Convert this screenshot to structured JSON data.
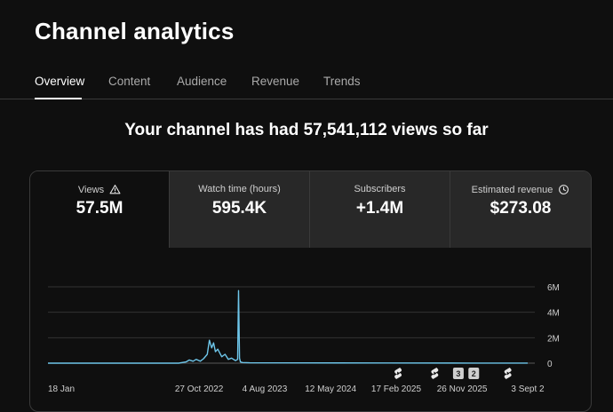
{
  "page": {
    "title": "Channel analytics"
  },
  "tabs": [
    {
      "label": "Overview",
      "active": true
    },
    {
      "label": "Content",
      "active": false
    },
    {
      "label": "Audience",
      "active": false
    },
    {
      "label": "Revenue",
      "active": false
    },
    {
      "label": "Trends",
      "active": false
    }
  ],
  "headline": "Your channel has had 57,541,112 views so far",
  "metrics": [
    {
      "label": "Views",
      "value": "57.5M",
      "icon": "warning-icon",
      "active": true
    },
    {
      "label": "Watch time (hours)",
      "value": "595.4K",
      "icon": "",
      "active": false
    },
    {
      "label": "Subscribers",
      "value": "+1.4M",
      "icon": "",
      "active": false
    },
    {
      "label": "Estimated revenue",
      "value": "$273.08",
      "icon": "clock-icon",
      "active": false
    }
  ],
  "chart_data": {
    "type": "line",
    "ylim": [
      0,
      6000000
    ],
    "y_ticks": [
      {
        "value": 6000000,
        "label": "6M"
      },
      {
        "value": 4000000,
        "label": "4M"
      },
      {
        "value": 2000000,
        "label": "2M"
      },
      {
        "value": 0,
        "label": "0"
      }
    ],
    "x_range": [
      "2021-01-18",
      "2025-09-03"
    ],
    "x_ticks": [
      {
        "date": "2021-01-18",
        "label": "18 Jan"
      },
      {
        "date": "2022-10-27",
        "label": "27 Oct 2022"
      },
      {
        "date": "2023-08-04",
        "label": "4 Aug 2023"
      },
      {
        "date": "2024-05-12",
        "label": "12 May 2024"
      },
      {
        "date": "2025-02-17",
        "label": "17 Feb 2025"
      },
      {
        "date": "2025-11-26",
        "label": "26 Nov 2025"
      },
      {
        "date": "2026-09-03",
        "label": "3 Sept 2"
      }
    ],
    "color": "#6ec6ea",
    "series": [
      {
        "x": [
          "2021-01-18",
          "2022-01-01",
          "2022-08-01",
          "2022-09-01",
          "2022-09-15",
          "2022-10-01",
          "2022-10-15",
          "2022-11-01",
          "2022-11-15",
          "2022-12-01",
          "2022-12-10",
          "2022-12-20",
          "2022-12-28",
          "2023-01-05",
          "2023-01-15",
          "2023-02-01",
          "2023-02-15",
          "2023-03-01",
          "2023-03-15",
          "2023-04-01",
          "2023-04-10",
          "2023-04-14",
          "2023-04-18",
          "2023-04-22",
          "2023-05-01",
          "2023-06-01",
          "2024-01-01",
          "2025-01-01",
          "2026-01-01",
          "2026-09-03"
        ],
        "y": [
          0,
          0,
          0,
          100000,
          250000,
          150000,
          300000,
          150000,
          350000,
          700000,
          1800000,
          1200000,
          1600000,
          900000,
          1100000,
          500000,
          700000,
          300000,
          400000,
          200000,
          300000,
          5700000,
          400000,
          100000,
          50000,
          30000,
          20000,
          15000,
          10000,
          10000
        ]
      }
    ],
    "markers": [
      {
        "date": "2025-02-25",
        "kind": "shorts-icon"
      },
      {
        "date": "2025-08-01",
        "kind": "shorts-icon"
      },
      {
        "date": "2025-11-10",
        "kind": "count-badge",
        "label": "3"
      },
      {
        "date": "2026-01-15",
        "kind": "count-badge",
        "label": "2"
      },
      {
        "date": "2026-06-10",
        "kind": "shorts-icon"
      }
    ]
  }
}
